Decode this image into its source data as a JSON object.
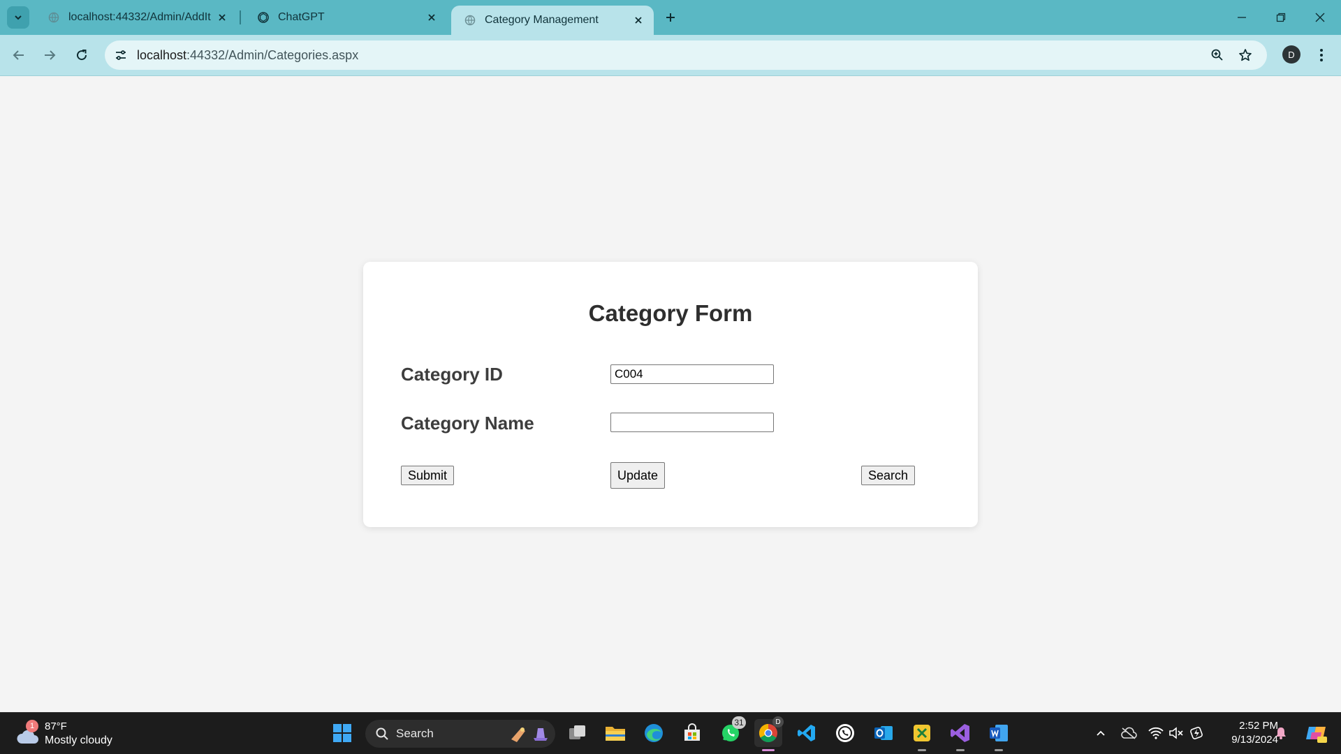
{
  "browser": {
    "tabs": [
      {
        "title": "localhost:44332/Admin/AddItem",
        "active": false
      },
      {
        "title": "ChatGPT",
        "active": false
      },
      {
        "title": "Category Management",
        "active": true
      }
    ],
    "url_host": "localhost",
    "url_rest": ":44332/Admin/Categories.aspx",
    "profile_initial": "D"
  },
  "form": {
    "title": "Category Form",
    "category_id_label": "Category ID",
    "category_id_value": "C004",
    "category_name_label": "Category Name",
    "category_name_value": "",
    "submit_label": "Submit",
    "update_label": "Update",
    "search_label": "Search"
  },
  "taskbar": {
    "weather_temp": "87°F",
    "weather_condition": "Mostly cloudy",
    "weather_badge": "1",
    "search_placeholder": "Search",
    "whatsapp_badge": "31",
    "chrome_badge": "D",
    "time": "2:52 PM",
    "date": "9/13/2024"
  },
  "colors": {
    "tabbar": "#5ab8c4",
    "toolbar": "#b8e3ea",
    "page_bg": "#f4f4f4",
    "card_bg": "#ffffff",
    "taskbar": "#1c1c1c"
  }
}
